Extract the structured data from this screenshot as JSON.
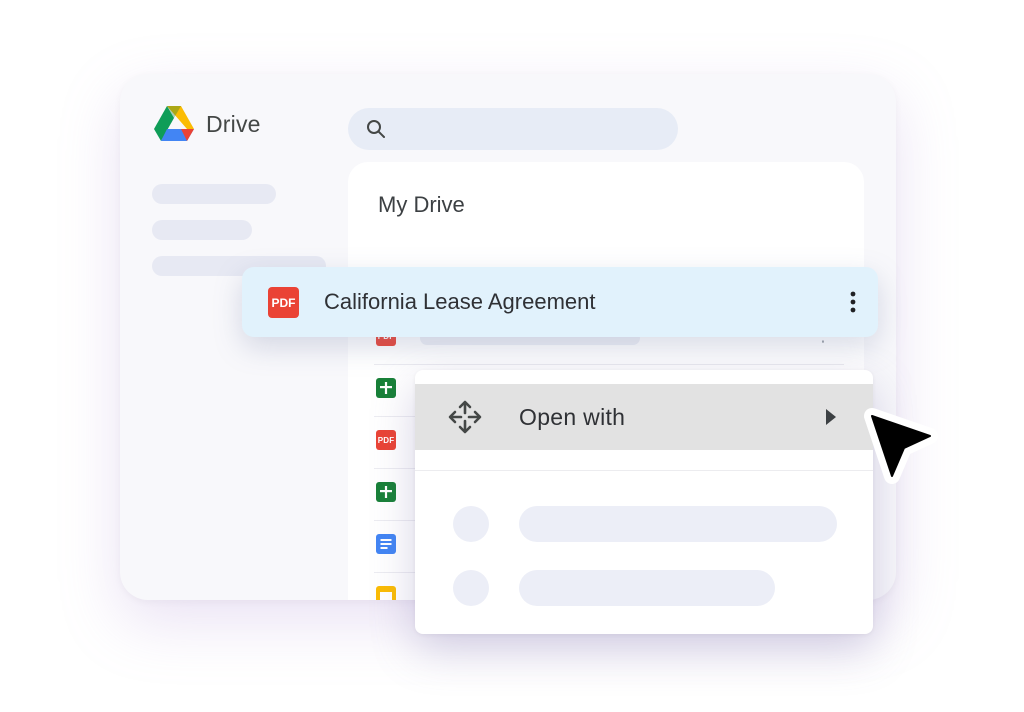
{
  "app": {
    "name": "Drive",
    "logo_icon": "google-drive-logo"
  },
  "search": {
    "icon": "search-icon",
    "placeholder": ""
  },
  "main": {
    "title": "My Drive",
    "files": [
      {
        "type": "pdf",
        "icon": "pdf-icon",
        "icon_label": "PDF"
      },
      {
        "type": "sheets",
        "icon": "sheets-icon"
      },
      {
        "type": "pdf",
        "icon": "pdf-icon",
        "icon_label": "PDF"
      },
      {
        "type": "sheets",
        "icon": "sheets-icon"
      },
      {
        "type": "docs",
        "icon": "docs-icon"
      },
      {
        "type": "slides",
        "icon": "slides-icon"
      }
    ]
  },
  "selected_file": {
    "name": "California Lease Agreement",
    "icon_label": "PDF",
    "more_icon": "more-vert-icon"
  },
  "context_menu": {
    "open_with": {
      "label": "Open with",
      "icon": "move-arrows-icon",
      "submenu_icon": "arrow-right-icon"
    }
  },
  "colors": {
    "pdf": "#ea4335",
    "sheets": "#188038",
    "docs": "#4285f4",
    "slides": "#fbbc04",
    "highlight": "#e1f2fc",
    "menu_hover": "#e2e2e2"
  }
}
